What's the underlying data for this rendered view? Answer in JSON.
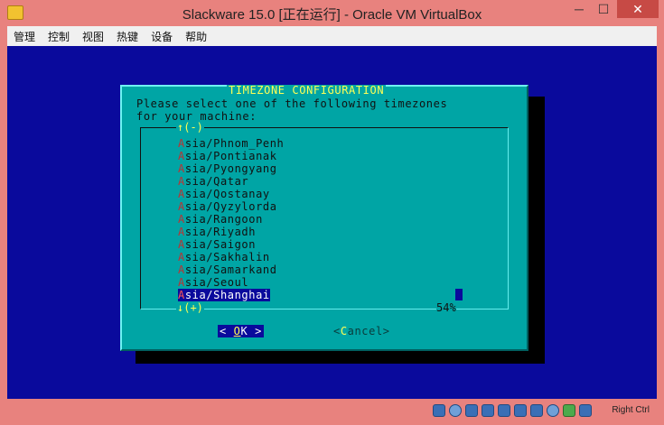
{
  "window": {
    "title": "Slackware 15.0 [正在运行] - Oracle VM VirtualBox",
    "minimize": "─",
    "maximize": "☐",
    "close": "✕"
  },
  "menu": [
    "管理",
    "控制",
    "视图",
    "热键",
    "设备",
    "帮助"
  ],
  "dialog": {
    "title": "TIMEZONE CONFIGURATION",
    "prompt_line1": "Please select one of the following timezones",
    "prompt_line2": "for your machine:",
    "scroll_up": "↑(-)",
    "scroll_down": "↓(+)",
    "scroll_percent": "54%",
    "items": [
      {
        "hot": "A",
        "rest": "sia/Phnom_Penh"
      },
      {
        "hot": "A",
        "rest": "sia/Pontianak"
      },
      {
        "hot": "A",
        "rest": "sia/Pyongyang"
      },
      {
        "hot": "A",
        "rest": "sia/Qatar"
      },
      {
        "hot": "A",
        "rest": "sia/Qostanay"
      },
      {
        "hot": "A",
        "rest": "sia/Qyzylorda"
      },
      {
        "hot": "A",
        "rest": "sia/Rangoon"
      },
      {
        "hot": "A",
        "rest": "sia/Riyadh"
      },
      {
        "hot": "A",
        "rest": "sia/Saigon"
      },
      {
        "hot": "A",
        "rest": "sia/Sakhalin"
      },
      {
        "hot": "A",
        "rest": "sia/Samarkand"
      },
      {
        "hot": "A",
        "rest": "sia/Seoul"
      },
      {
        "hot": "A",
        "rest": "sia/Shanghai"
      }
    ],
    "selected_item": "Asia/Shanghai",
    "ok": {
      "left": "<",
      "hot": "O",
      "rest": "K",
      "right": ">"
    },
    "cancel": {
      "left": "<",
      "hot": "C",
      "rest": "ancel",
      "right": ">"
    }
  },
  "statusbar": {
    "host_key": "Right Ctrl",
    "icons": [
      "hard-disk-icon",
      "optical-drive-icon",
      "audio-icon",
      "network-icon",
      "usb-icon",
      "shared-folder-icon",
      "display-icon",
      "video-capture-icon",
      "mouse-integration-icon",
      "keyboard-icon"
    ]
  },
  "colors": {
    "vm_background": "#0a0a9c",
    "dialog_background": "#00a5a5",
    "dialog_title": "#ffff55",
    "hotkey": "#c03030",
    "window_frame": "#e8827e"
  }
}
